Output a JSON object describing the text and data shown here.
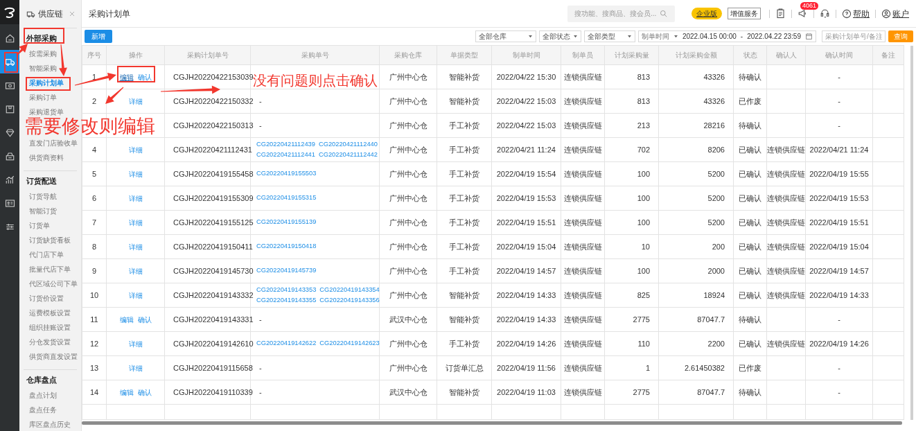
{
  "rail": {
    "items": [
      {
        "kind": "home",
        "selected": false
      },
      {
        "kind": "truck",
        "selected": true
      },
      {
        "kind": "cash",
        "selected": false
      },
      {
        "kind": "box",
        "selected": false
      },
      {
        "kind": "diamond",
        "selected": false
      },
      {
        "kind": "register",
        "selected": false
      },
      {
        "kind": "chart",
        "selected": false
      },
      {
        "kind": "card",
        "selected": false
      },
      {
        "kind": "sliders",
        "selected": false
      }
    ]
  },
  "sidebar": {
    "title": "供应链",
    "groups": [
      {
        "title": "外部采购",
        "items": [
          {
            "label": "按需采购",
            "selected": false
          },
          {
            "label": "智能采购",
            "selected": false
          },
          {
            "label": "采购计划单",
            "selected": true
          },
          {
            "label": "采购订单",
            "selected": false
          },
          {
            "label": "采购退货单",
            "selected": false
          },
          {
            "label": "直发门店验收单",
            "selected": false
          },
          {
            "label": "供货商资料",
            "selected": false
          }
        ]
      },
      {
        "title": "订货配送",
        "items": [
          {
            "label": "订货导航",
            "selected": false
          },
          {
            "label": "智能订货",
            "selected": false
          },
          {
            "label": "订货单",
            "selected": false
          },
          {
            "label": "订货缺货看板",
            "selected": false
          },
          {
            "label": "代门店下单",
            "selected": false
          },
          {
            "label": "批量代店下单",
            "selected": false
          },
          {
            "label": "代区域公司下单",
            "selected": false
          },
          {
            "label": "订货价设置",
            "selected": false
          },
          {
            "label": "运费模板设置",
            "selected": false
          },
          {
            "label": "组织挂账设置",
            "selected": false
          },
          {
            "label": "分仓发货设置",
            "selected": false
          },
          {
            "label": "供货商直发设置",
            "selected": false
          }
        ]
      },
      {
        "title": "仓库盘点",
        "items": [
          {
            "label": "盘点计划",
            "selected": false
          },
          {
            "label": "盘点任务",
            "selected": false
          },
          {
            "label": "库区盘点历史",
            "selected": false
          }
        ]
      }
    ]
  },
  "header": {
    "title": "采购计划单",
    "search": {
      "placeholder": "搜功能、搜商品、搜会员..."
    },
    "edition": "企业版",
    "service": "增值服务",
    "notice_count": "4061",
    "help": "帮助",
    "account": "账户"
  },
  "toolbar": {
    "add": "新增",
    "filters": [
      {
        "value": "全部仓库"
      },
      {
        "value": "全部状态"
      },
      {
        "value": "全部类型"
      }
    ],
    "date_field": "制单时间",
    "date_from": "2022.04.15 00:00",
    "date_sep": "-",
    "date_to": "2022.04.22 23:59",
    "keyword": {
      "placeholder": "采购计划单号/备注"
    },
    "query": "查询"
  },
  "table": {
    "columns": [
      "序号",
      "操作",
      "采购计划单号",
      "采购单号",
      "采购仓库",
      "单据类型",
      "制单时间",
      "制单员",
      "计划采购量",
      "计划采购金额",
      "状态",
      "确认人",
      "确认时间",
      "备注"
    ],
    "rows": [
      {
        "no": "1",
        "actions": [
          {
            "label": "编辑",
            "hovered": true
          },
          {
            "label": "确认",
            "hovered": false
          }
        ],
        "plan_no": "CGJH20220422153039",
        "warehouse": "广州中心仓",
        "type": "智能补货",
        "created": "2022/04/22 15:30",
        "creator": "连锁供应链",
        "qty": "813",
        "amount": "43326",
        "status": "待确认",
        "confirm_time": "-"
      },
      {
        "no": "2",
        "actions": [
          {
            "label": "详细",
            "hovered": false
          }
        ],
        "plan_no": "CGJH20220422150332",
        "order_no": "-",
        "warehouse": "广州中心仓",
        "type": "智能补货",
        "created": "2022/04/22 15:03",
        "creator": "连锁供应链",
        "qty": "813",
        "amount": "43326",
        "status": "已作废",
        "confirm_time": "-"
      },
      {
        "plan_no": "CGJH20220422150313",
        "order_no": "-",
        "warehouse": "广州中心仓",
        "type": "手工补货",
        "created": "2022/04/22 15:03",
        "creator": "连锁供应链",
        "qty": "213",
        "amount": "28216",
        "status": "待确认",
        "confirm_time": "-"
      },
      {
        "no": "4",
        "actions": [
          {
            "label": "详细",
            "hovered": false
          }
        ],
        "plan_no": "CGJH20220421112431",
        "orders": [
          "CG20220421112439",
          "CG20220421112440",
          "CG20220421112441",
          "CG20220421112442"
        ],
        "warehouse": "广州中心仓",
        "type": "手工补货",
        "created": "2022/04/21 11:24",
        "creator": "连锁供应链",
        "qty": "702",
        "amount": "8206",
        "status": "已确认",
        "confirmer": "连锁供应链",
        "confirm_time": "2022/04/21 11:24"
      },
      {
        "no": "5",
        "actions": [
          {
            "label": "详细",
            "hovered": false
          }
        ],
        "plan_no": "CGJH20220419155458",
        "orders": [
          "CG20220419155503"
        ],
        "warehouse": "广州中心仓",
        "type": "手工补货",
        "created": "2022/04/19 15:54",
        "creator": "连锁供应链",
        "qty": "100",
        "amount": "5200",
        "status": "已确认",
        "confirmer": "连锁供应链",
        "confirm_time": "2022/04/19 15:55"
      },
      {
        "no": "6",
        "actions": [
          {
            "label": "详细",
            "hovered": false
          }
        ],
        "plan_no": "CGJH20220419155309",
        "orders": [
          "CG20220419155315"
        ],
        "warehouse": "广州中心仓",
        "type": "手工补货",
        "created": "2022/04/19 15:53",
        "creator": "连锁供应链",
        "qty": "100",
        "amount": "5200",
        "status": "已确认",
        "confirmer": "连锁供应链",
        "confirm_time": "2022/04/19 15:53"
      },
      {
        "no": "7",
        "actions": [
          {
            "label": "详细",
            "hovered": false
          }
        ],
        "plan_no": "CGJH20220419155125",
        "orders": [
          "CG20220419155139"
        ],
        "warehouse": "广州中心仓",
        "type": "手工补货",
        "created": "2022/04/19 15:51",
        "creator": "连锁供应链",
        "qty": "100",
        "amount": "5200",
        "status": "已确认",
        "confirmer": "连锁供应链",
        "confirm_time": "2022/04/19 15:51"
      },
      {
        "no": "8",
        "actions": [
          {
            "label": "详细",
            "hovered": false
          }
        ],
        "plan_no": "CGJH20220419150411",
        "orders": [
          "CG20220419150418"
        ],
        "warehouse": "广州中心仓",
        "type": "手工补货",
        "created": "2022/04/19 15:04",
        "creator": "连锁供应链",
        "qty": "10",
        "amount": "200",
        "status": "已确认",
        "confirmer": "连锁供应链",
        "confirm_time": "2022/04/19 15:04"
      },
      {
        "no": "9",
        "actions": [
          {
            "label": "详细",
            "hovered": false
          }
        ],
        "plan_no": "CGJH20220419145730",
        "orders": [
          "CG20220419145739"
        ],
        "warehouse": "广州中心仓",
        "type": "手工补货",
        "created": "2022/04/19 14:57",
        "creator": "连锁供应链",
        "qty": "100",
        "amount": "2000",
        "status": "已确认",
        "confirmer": "连锁供应链",
        "confirm_time": "2022/04/19 14:57"
      },
      {
        "no": "10",
        "actions": [
          {
            "label": "详细",
            "hovered": false
          }
        ],
        "plan_no": "CGJH20220419143332",
        "orders": [
          "CG20220419143353",
          "CG20220419143354",
          "CG20220419143355",
          "CG20220419143356"
        ],
        "warehouse": "广州中心仓",
        "type": "智能补货",
        "created": "2022/04/19 14:33",
        "creator": "连锁供应链",
        "qty": "825",
        "amount": "18924",
        "status": "已确认",
        "confirmer": "连锁供应链",
        "confirm_time": "2022/04/19 14:33"
      },
      {
        "no": "11",
        "actions": [
          {
            "label": "编辑",
            "hovered": false
          },
          {
            "label": "确认",
            "hovered": false
          }
        ],
        "plan_no": "CGJH20220419143331",
        "order_no": "-",
        "warehouse": "武汉中心仓",
        "type": "智能补货",
        "created": "2022/04/19 14:33",
        "creator": "连锁供应链",
        "qty": "2775",
        "amount": "87047.7",
        "status": "待确认",
        "confirm_time": "-"
      },
      {
        "no": "12",
        "actions": [
          {
            "label": "详细",
            "hovered": false
          }
        ],
        "plan_no": "CGJH20220419142610",
        "orders": [
          "CG20220419142622",
          "CG20220419142623"
        ],
        "warehouse": "广州中心仓",
        "type": "手工补货",
        "created": "2022/04/19 14:26",
        "creator": "连锁供应链",
        "qty": "110",
        "amount": "2200",
        "status": "已确认",
        "confirmer": "连锁供应链",
        "confirm_time": "2022/04/19 14:26"
      },
      {
        "no": "13",
        "actions": [
          {
            "label": "详细",
            "hovered": false
          }
        ],
        "plan_no": "CGJH20220419115658",
        "order_no": "-",
        "warehouse": "广州中心仓",
        "type": "订货单汇总",
        "created": "2022/04/19 11:56",
        "creator": "连锁供应链",
        "qty": "1",
        "amount": "2.61450382",
        "status": "已作废",
        "confirm_time": "-"
      },
      {
        "no": "14",
        "actions": [
          {
            "label": "编辑",
            "hovered": false
          },
          {
            "label": "确认",
            "hovered": false
          }
        ],
        "plan_no": "CGJH20220419110339",
        "order_no": "-",
        "warehouse": "武汉中心仓",
        "type": "智能补货",
        "created": "2022/04/19 11:03",
        "creator": "连锁供应链",
        "qty": "2775",
        "amount": "87047.7",
        "status": "待确认",
        "confirm_time": "-"
      }
    ]
  },
  "annotations": [
    {
      "text": "没有问题则点击确认"
    },
    {
      "text": "需要修改则编辑"
    }
  ]
}
